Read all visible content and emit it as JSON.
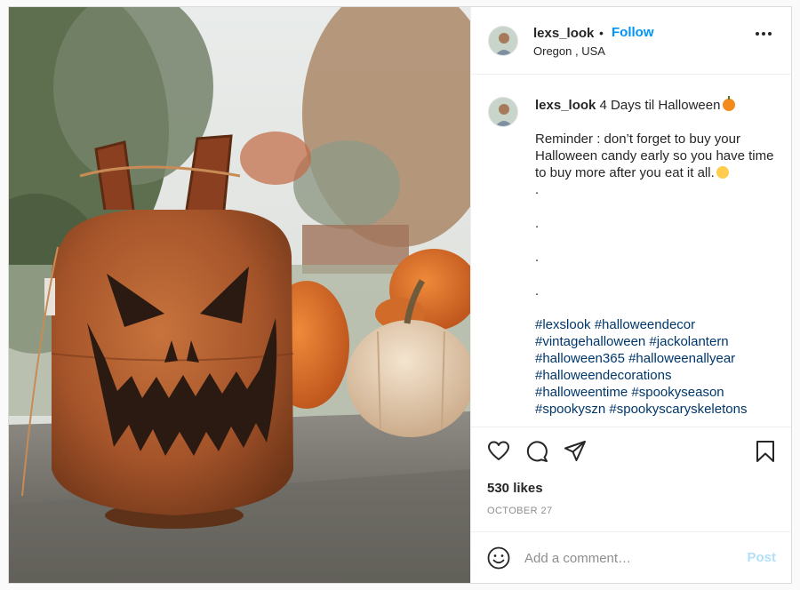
{
  "post": {
    "username": "lexs_look",
    "separator": "•",
    "follow_label": "Follow",
    "location": "Oregon , USA",
    "more_icon": "more-horizontal-icon"
  },
  "caption": {
    "username": "lexs_look",
    "title": "4 Days til Halloween",
    "title_emoji": "pumpkin-emoji",
    "body": "Reminder : don’t forget to buy your Halloween candy early so you have time to buy more after you eat it all.",
    "body_emoji": "hugging-face-emoji",
    "dots": [
      ".",
      ".",
      ".",
      "."
    ],
    "hashtag_lines": [
      "#lexslook #halloweendecor",
      "#vintagehalloween #jackolantern",
      "#halloween365 #halloweenallyear",
      "#halloweendecorations",
      "#halloweentime #spookyseason",
      "#spookyszn #spookyscaryskeletons"
    ]
  },
  "actions": {
    "like_icon": "heart-icon",
    "comment_icon": "comment-icon",
    "share_icon": "paper-plane-icon",
    "save_icon": "bookmark-icon"
  },
  "likes_text": "530 likes",
  "date_text": "OCTOBER 27",
  "comment": {
    "emoji_icon": "smiley-icon",
    "placeholder": "Add a comment…",
    "post_label": "Post"
  },
  "colors": {
    "link_blue": "#0095f6",
    "hashtag_blue": "#00376b",
    "post_disabled": "#b2dffc",
    "muted": "#8e8e8e",
    "text": "#262626"
  }
}
